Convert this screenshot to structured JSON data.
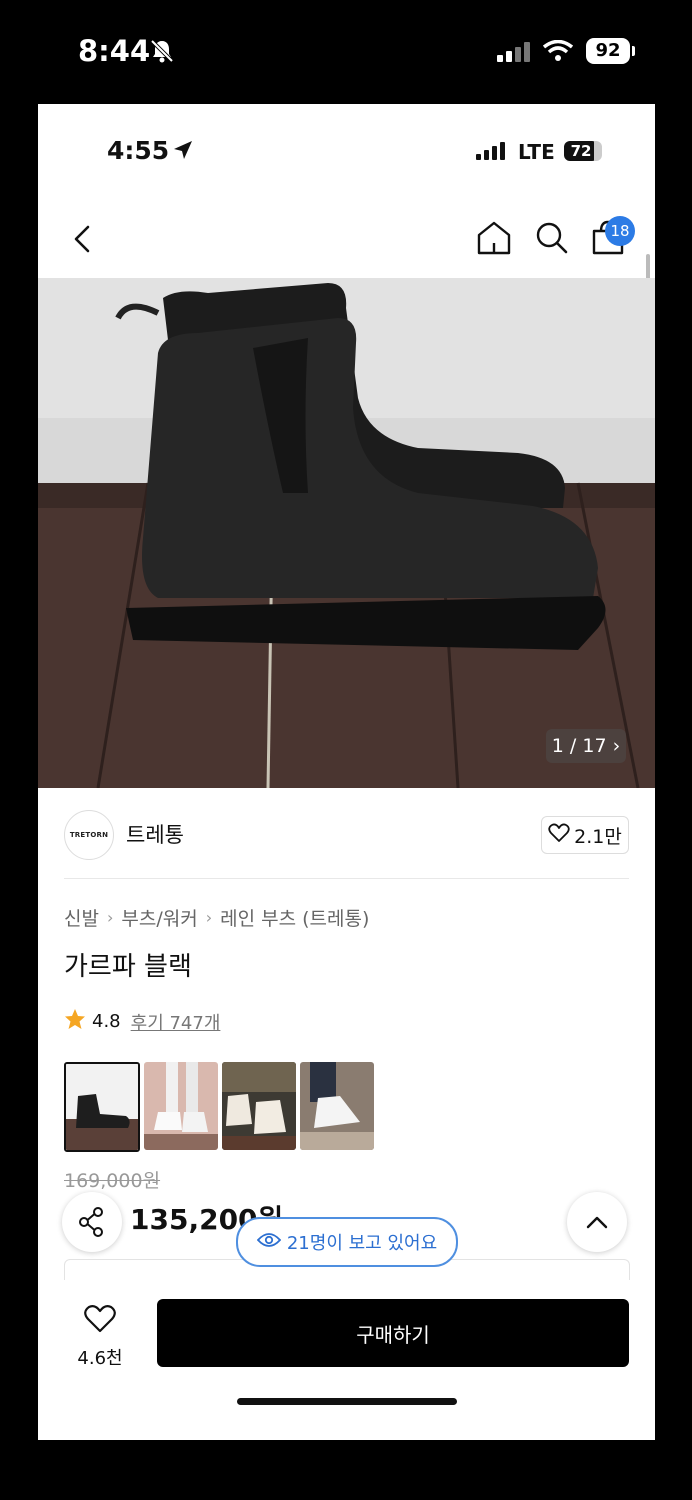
{
  "outer_status": {
    "time": "8:44",
    "battery": "92",
    "bell_icon": "bell-slash-icon"
  },
  "inner_status": {
    "time": "4:55",
    "network": "LTE",
    "battery": "72"
  },
  "nav": {
    "cart_count": "18",
    "icons": [
      "back-icon",
      "home-icon",
      "search-icon",
      "cart-bag-icon"
    ]
  },
  "gallery": {
    "pager": "1 / 17"
  },
  "brand": {
    "logo_text": "TRETORN",
    "name": "트레통",
    "likes": "2.1만"
  },
  "breadcrumbs": [
    "신발",
    "부츠/워커",
    "레인 부츠 (트레통)"
  ],
  "product": {
    "title": "가르파 블랙",
    "rating": "4.8",
    "reviews": "후기 747개",
    "original_price": "169,000원",
    "sale_price": "135,200원"
  },
  "viewing": "21명이 보고 있어요",
  "bottom": {
    "wish_count": "4.6천",
    "buy_label": "구매하기"
  },
  "colors": {
    "accent_blue": "#2c7be5",
    "star": "#f5a623",
    "buy_button": "#000000"
  }
}
